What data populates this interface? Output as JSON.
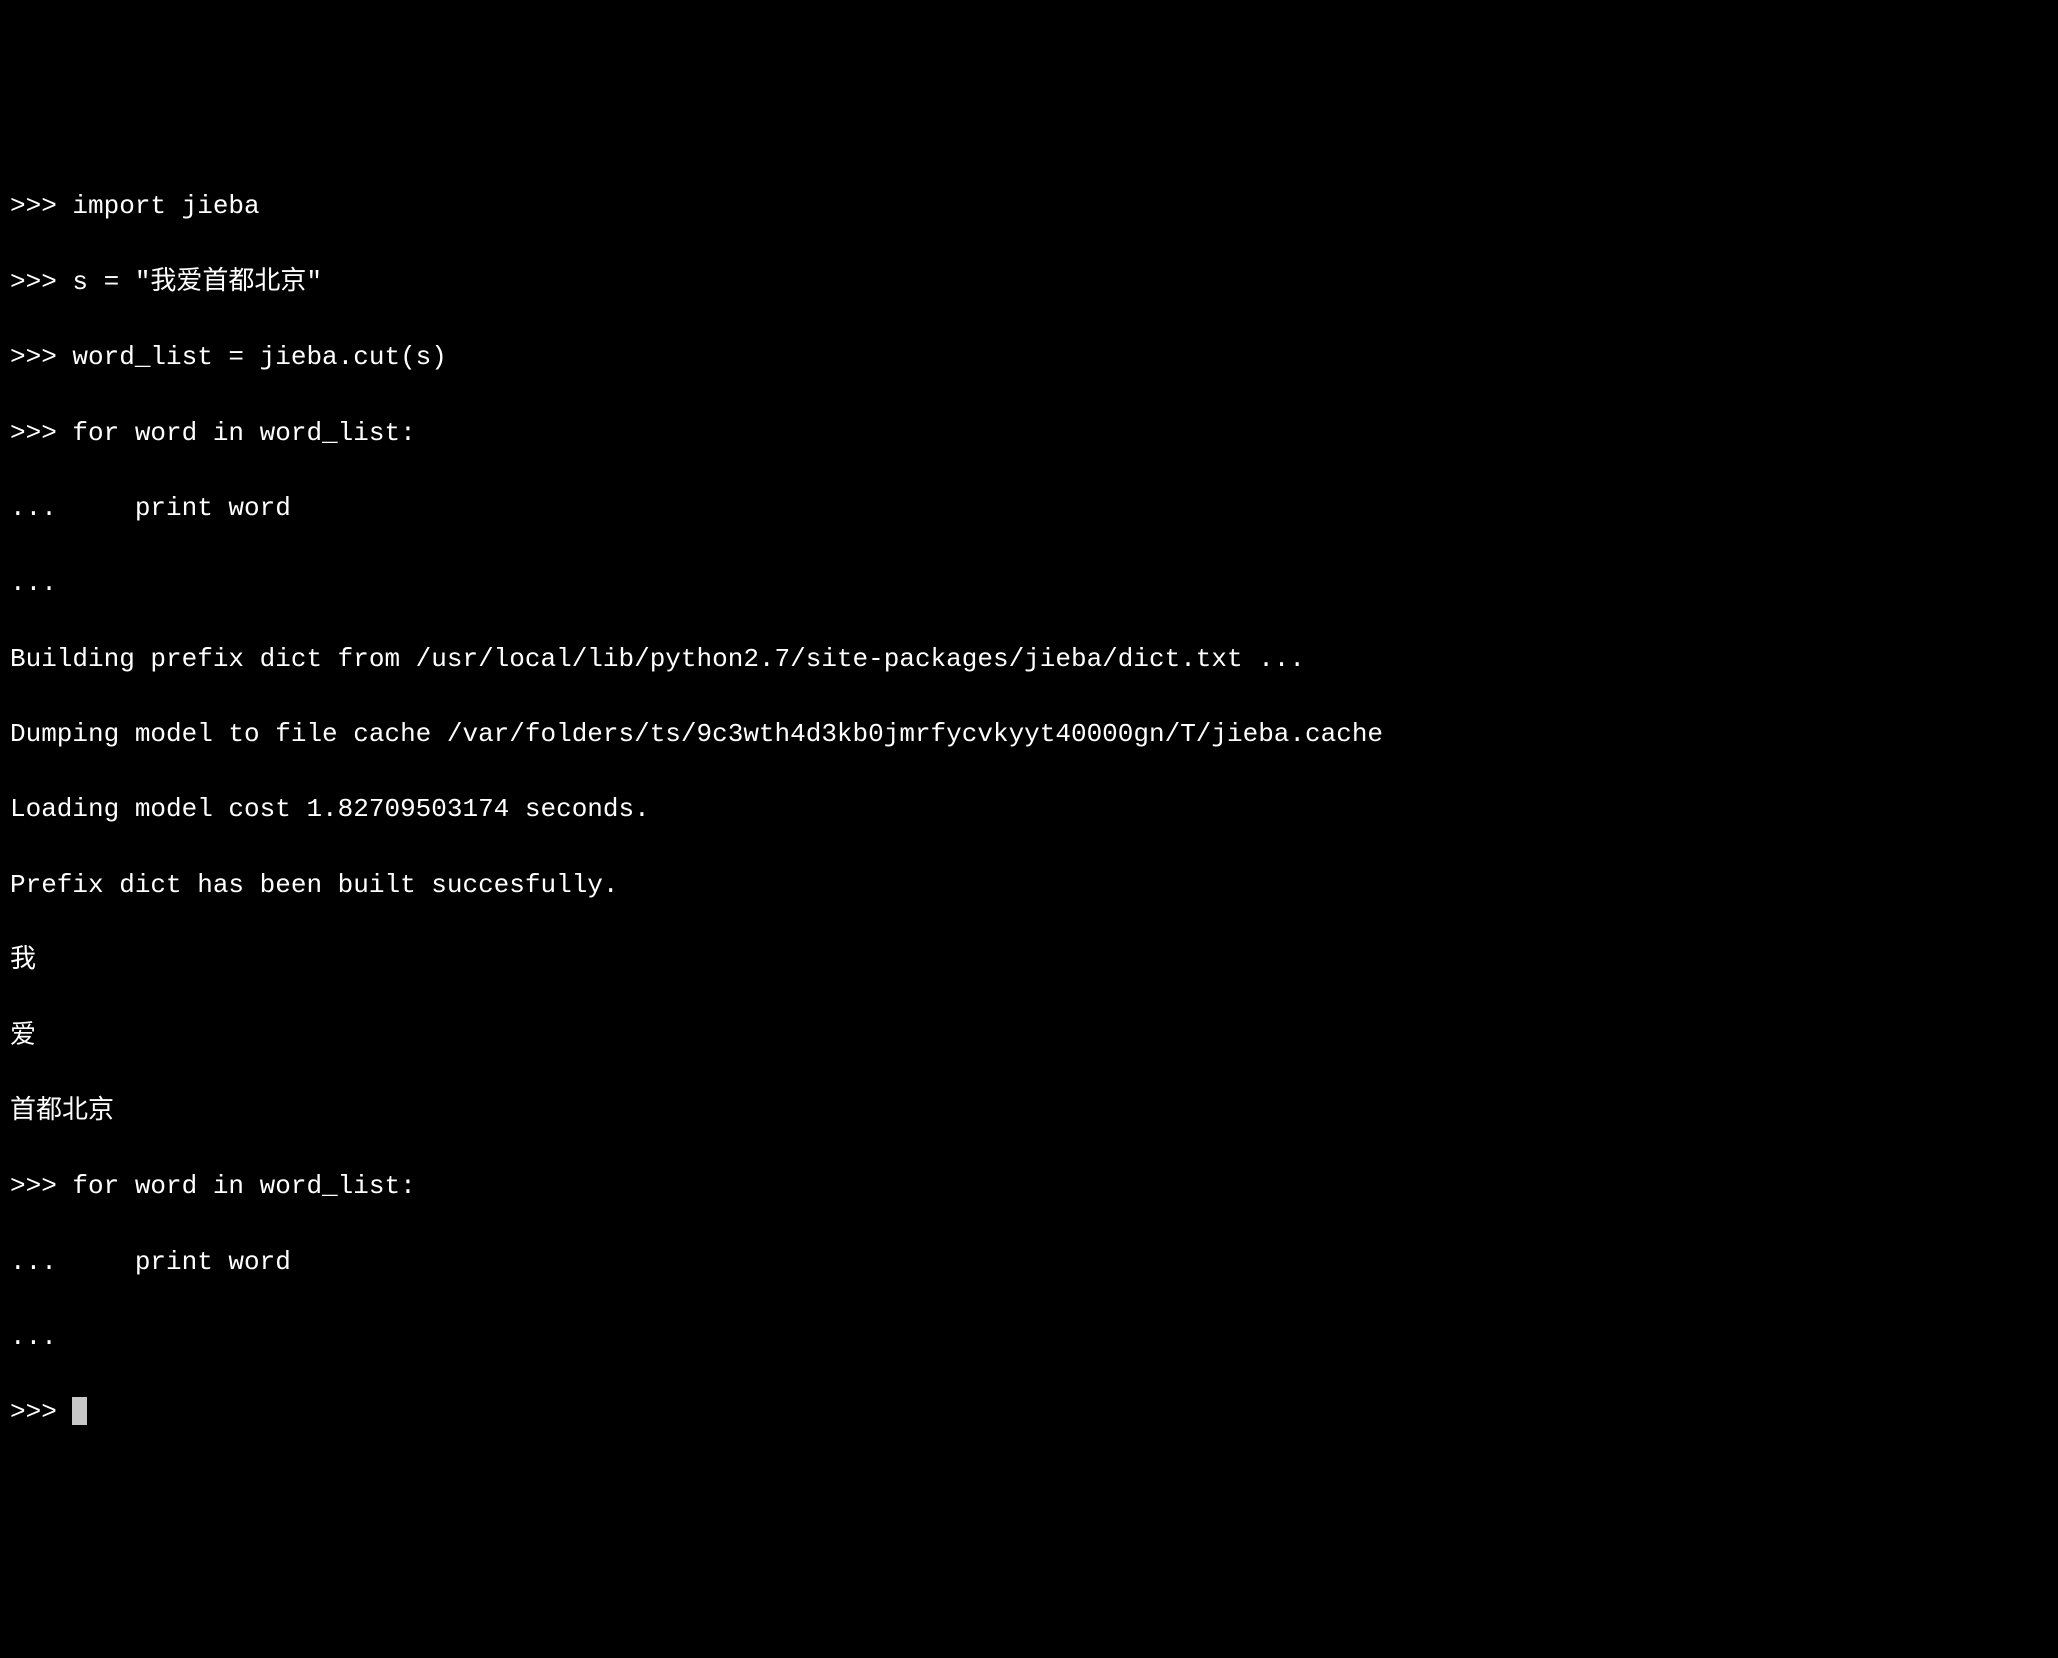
{
  "terminal": {
    "lines": [
      ">>> import jieba",
      ">>> s = \"我爱首都北京\"",
      ">>> word_list = jieba.cut(s)",
      ">>> for word in word_list:",
      "...     print word",
      "...",
      "Building prefix dict from /usr/local/lib/python2.7/site-packages/jieba/dict.txt ...",
      "Dumping model to file cache /var/folders/ts/9c3wth4d3kb0jmrfycvkyyt40000gn/T/jieba.cache",
      "Loading model cost 1.82709503174 seconds.",
      "Prefix dict has been built succesfully.",
      "我",
      "爱",
      "首都北京",
      ">>> for word in word_list:",
      "...     print word",
      "...",
      ">>> "
    ],
    "prompt_primary": ">>> ",
    "prompt_continuation": "... "
  }
}
